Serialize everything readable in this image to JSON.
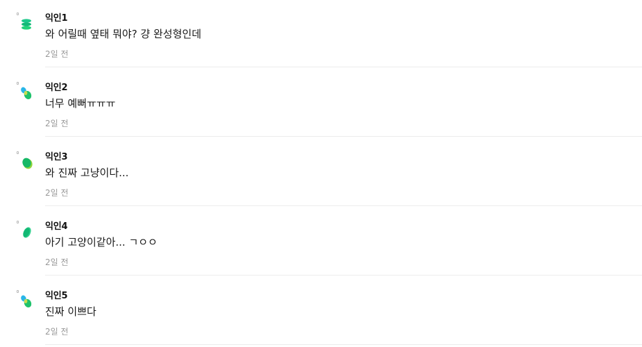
{
  "comments": [
    {
      "author": "익인1",
      "text": "와 어릴때 옆태 뭐야? 걍 완성형인데",
      "time": "2일 전",
      "avatar_icon": "green-stack-icon",
      "avatar_colors": [
        "#1cc88a",
        "#22d37a"
      ]
    },
    {
      "author": "익인2",
      "text": "너무 예뻐ㅠㅠㅠ",
      "time": "2일 전",
      "avatar_icon": "green-blue-blob-icon",
      "avatar_colors": [
        "#29b6e8",
        "#1fc26b"
      ]
    },
    {
      "author": "익인3",
      "text": "와 진짜 고냥이다...",
      "time": "2일 전",
      "avatar_icon": "green-leaf-icon",
      "avatar_colors": [
        "#16b866",
        "#8fd63a"
      ]
    },
    {
      "author": "익인4",
      "text": "아기 고양이같아... ㄱㅇㅇ",
      "time": "2일 전",
      "avatar_icon": "green-leaf-icon",
      "avatar_colors": [
        "#12b874",
        "#2ecf8c"
      ]
    },
    {
      "author": "익인5",
      "text": "진짜 이쁘다",
      "time": "2일 전",
      "avatar_icon": "green-blue-blob-icon",
      "avatar_colors": [
        "#29b6e8",
        "#1fc26b"
      ]
    }
  ]
}
